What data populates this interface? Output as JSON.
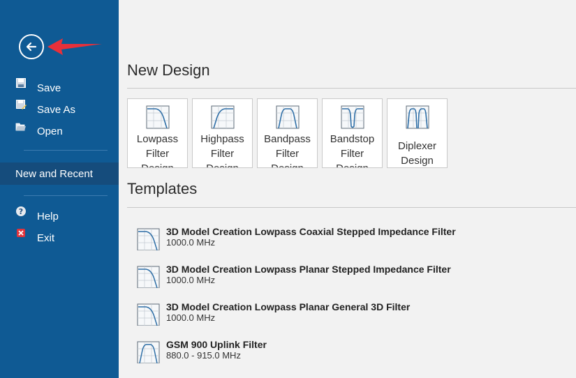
{
  "sidebar": {
    "back_icon": "arrow-left-circle-icon",
    "annotation_arrow_color": "#e8303a",
    "items": [
      {
        "label": "Save",
        "icon": "save-icon"
      },
      {
        "label": "Save As",
        "icon": "save-as-icon"
      },
      {
        "label": "Open",
        "icon": "open-folder-icon"
      }
    ],
    "selected": {
      "label": "New and Recent"
    },
    "bottom_items": [
      {
        "label": "Help",
        "icon": "help-icon"
      },
      {
        "label": "Exit",
        "icon": "exit-icon"
      }
    ],
    "colors": {
      "background": "#0f5a94",
      "selected": "#154c7c"
    }
  },
  "main": {
    "new_design": {
      "title": "New Design",
      "tiles": [
        {
          "label": "Lowpass\nFilter\nDesign",
          "icon": "lowpass-filter-icon"
        },
        {
          "label": "Highpass\nFilter\nDesign",
          "icon": "highpass-filter-icon"
        },
        {
          "label": "Bandpass\nFilter\nDesign",
          "icon": "bandpass-filter-icon"
        },
        {
          "label": "Bandstop\nFilter\nDesign",
          "icon": "bandstop-filter-icon"
        },
        {
          "label": "Diplexer\nDesign",
          "icon": "diplexer-icon"
        }
      ]
    },
    "templates": {
      "title": "Templates",
      "items": [
        {
          "title": "3D Model Creation Lowpass Coaxial Stepped Impedance Filter",
          "subtitle": "1000.0 MHz",
          "icon": "lowpass-filter-icon"
        },
        {
          "title": "3D Model Creation Lowpass Planar Stepped Impedance Filter",
          "subtitle": "1000.0 MHz",
          "icon": "lowpass-filter-icon"
        },
        {
          "title": "3D Model Creation Lowpass Planar General 3D Filter",
          "subtitle": "1000.0 MHz",
          "icon": "lowpass-filter-icon"
        },
        {
          "title": "GSM 900 Uplink Filter",
          "subtitle": "880.0 - 915.0 MHz",
          "icon": "bandpass-filter-icon"
        }
      ]
    }
  }
}
